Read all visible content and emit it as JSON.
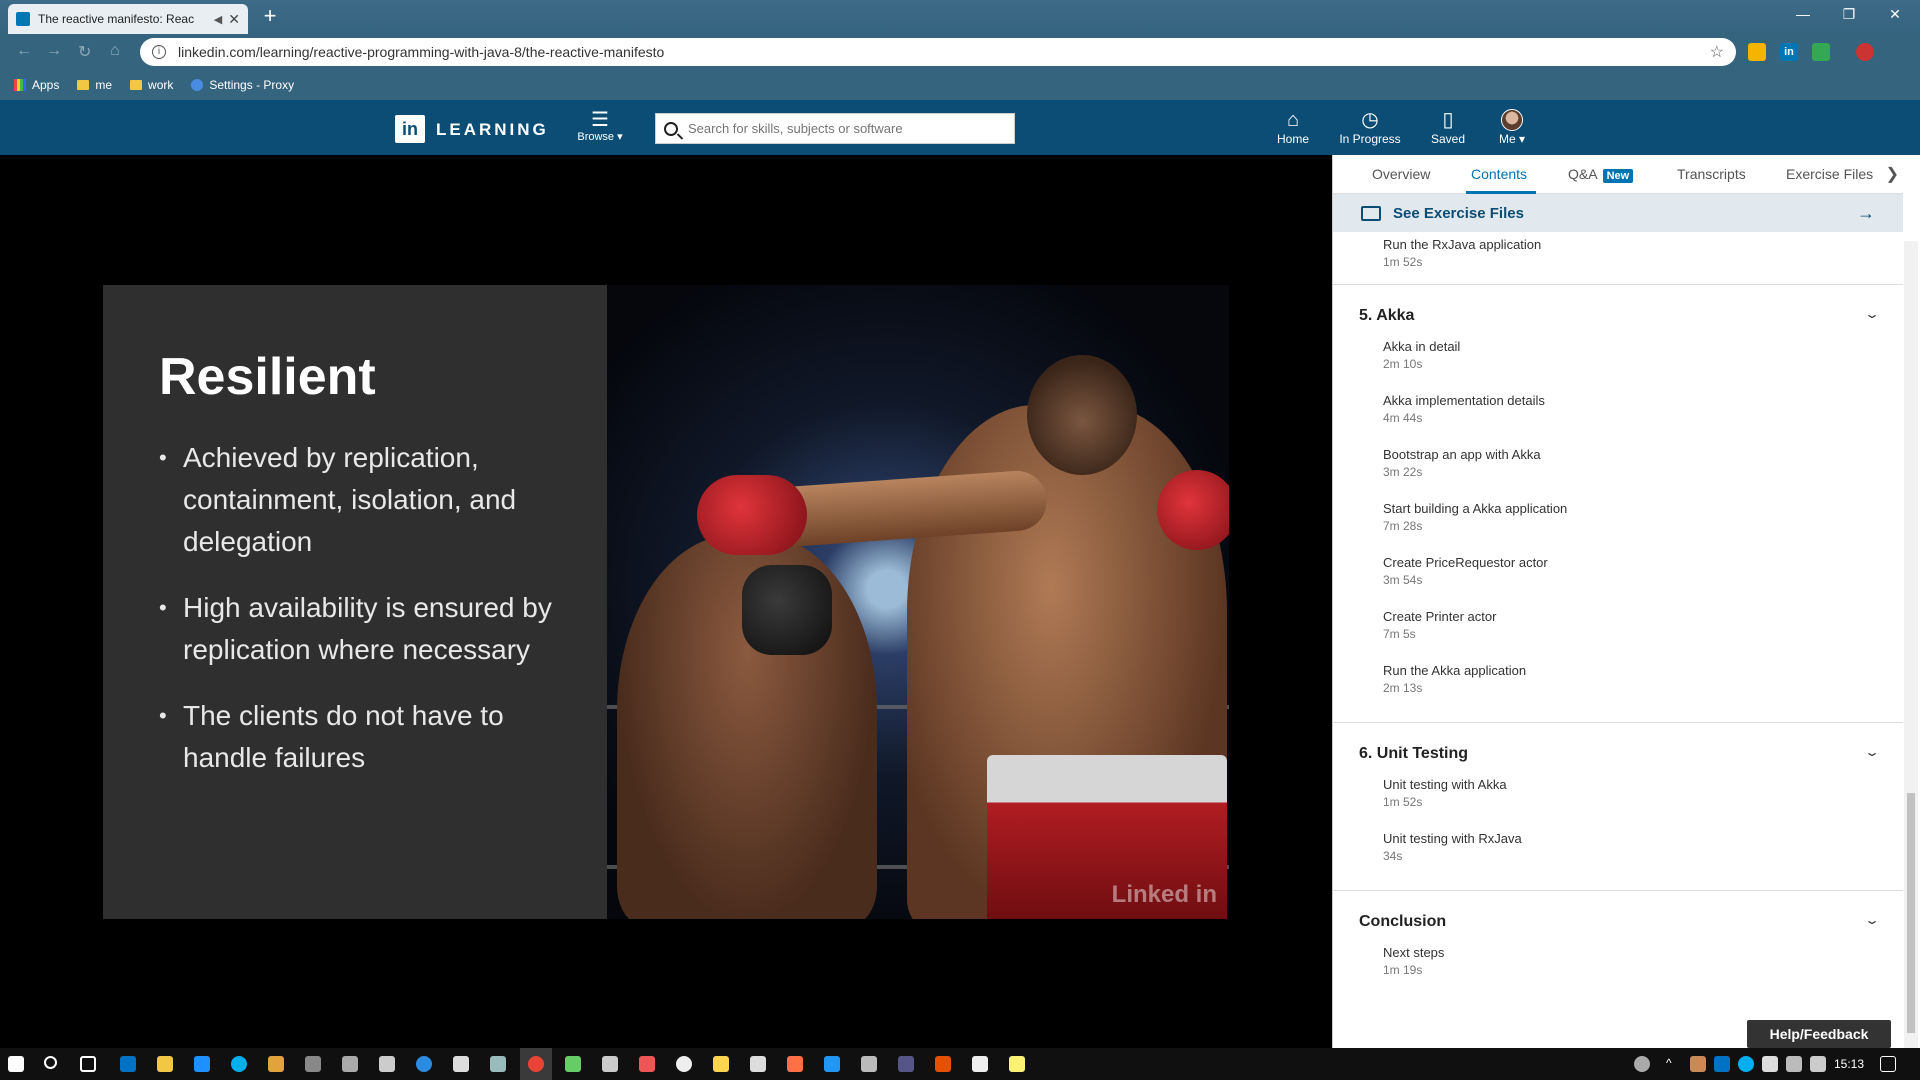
{
  "browser": {
    "tab_title": "The reactive manifesto: Reac",
    "url": "linkedin.com/learning/reactive-programming-with-java-8/the-reactive-manifesto",
    "bookmarks": [
      "Apps",
      "me",
      "work",
      "Settings - Proxy"
    ]
  },
  "header": {
    "logo_text": "LEARNING",
    "browse_label": "Browse",
    "search_placeholder": "Search for skills, subjects or software",
    "nav": {
      "home": "Home",
      "in_progress": "In Progress",
      "saved": "Saved",
      "me": "Me"
    }
  },
  "slide": {
    "title": "Resilient",
    "bullets": [
      "Achieved by replication, containment, isolation, and delegation",
      "High availability is ensured by replication where necessary",
      "The clients do not have to handle failures"
    ],
    "watermark": "Linked in"
  },
  "panel": {
    "tabs": {
      "overview": "Overview",
      "contents": "Contents",
      "qa": "Q&A",
      "qa_badge": "New",
      "transcripts": "Transcripts",
      "exercise_files": "Exercise Files"
    },
    "exercise_link": "See Exercise Files",
    "prev_item": {
      "title": "Run the RxJava application",
      "duration": "1m 52s"
    },
    "sections": [
      {
        "title": "5. Akka",
        "items": [
          {
            "title": "Akka in detail",
            "duration": "2m 10s"
          },
          {
            "title": "Akka implementation details",
            "duration": "4m 44s"
          },
          {
            "title": "Bootstrap an app with Akka",
            "duration": "3m 22s"
          },
          {
            "title": "Start building a Akka application",
            "duration": "7m 28s"
          },
          {
            "title": "Create PriceRequestor actor",
            "duration": "3m 54s"
          },
          {
            "title": "Create Printer actor",
            "duration": "7m 5s"
          },
          {
            "title": "Run the Akka application",
            "duration": "2m 13s"
          }
        ]
      },
      {
        "title": "6. Unit Testing",
        "items": [
          {
            "title": "Unit testing with Akka",
            "duration": "1m 52s"
          },
          {
            "title": "Unit testing with RxJava",
            "duration": "34s"
          }
        ]
      },
      {
        "title": "Conclusion",
        "items": [
          {
            "title": "Next steps",
            "duration": "1m 19s"
          }
        ]
      }
    ],
    "help_button": "Help/Feedback"
  },
  "taskbar": {
    "time": "15:13"
  },
  "colors": {
    "brand": "#0b4d74",
    "accent": "#0073b1",
    "slide_bg": "#2f2f30"
  }
}
